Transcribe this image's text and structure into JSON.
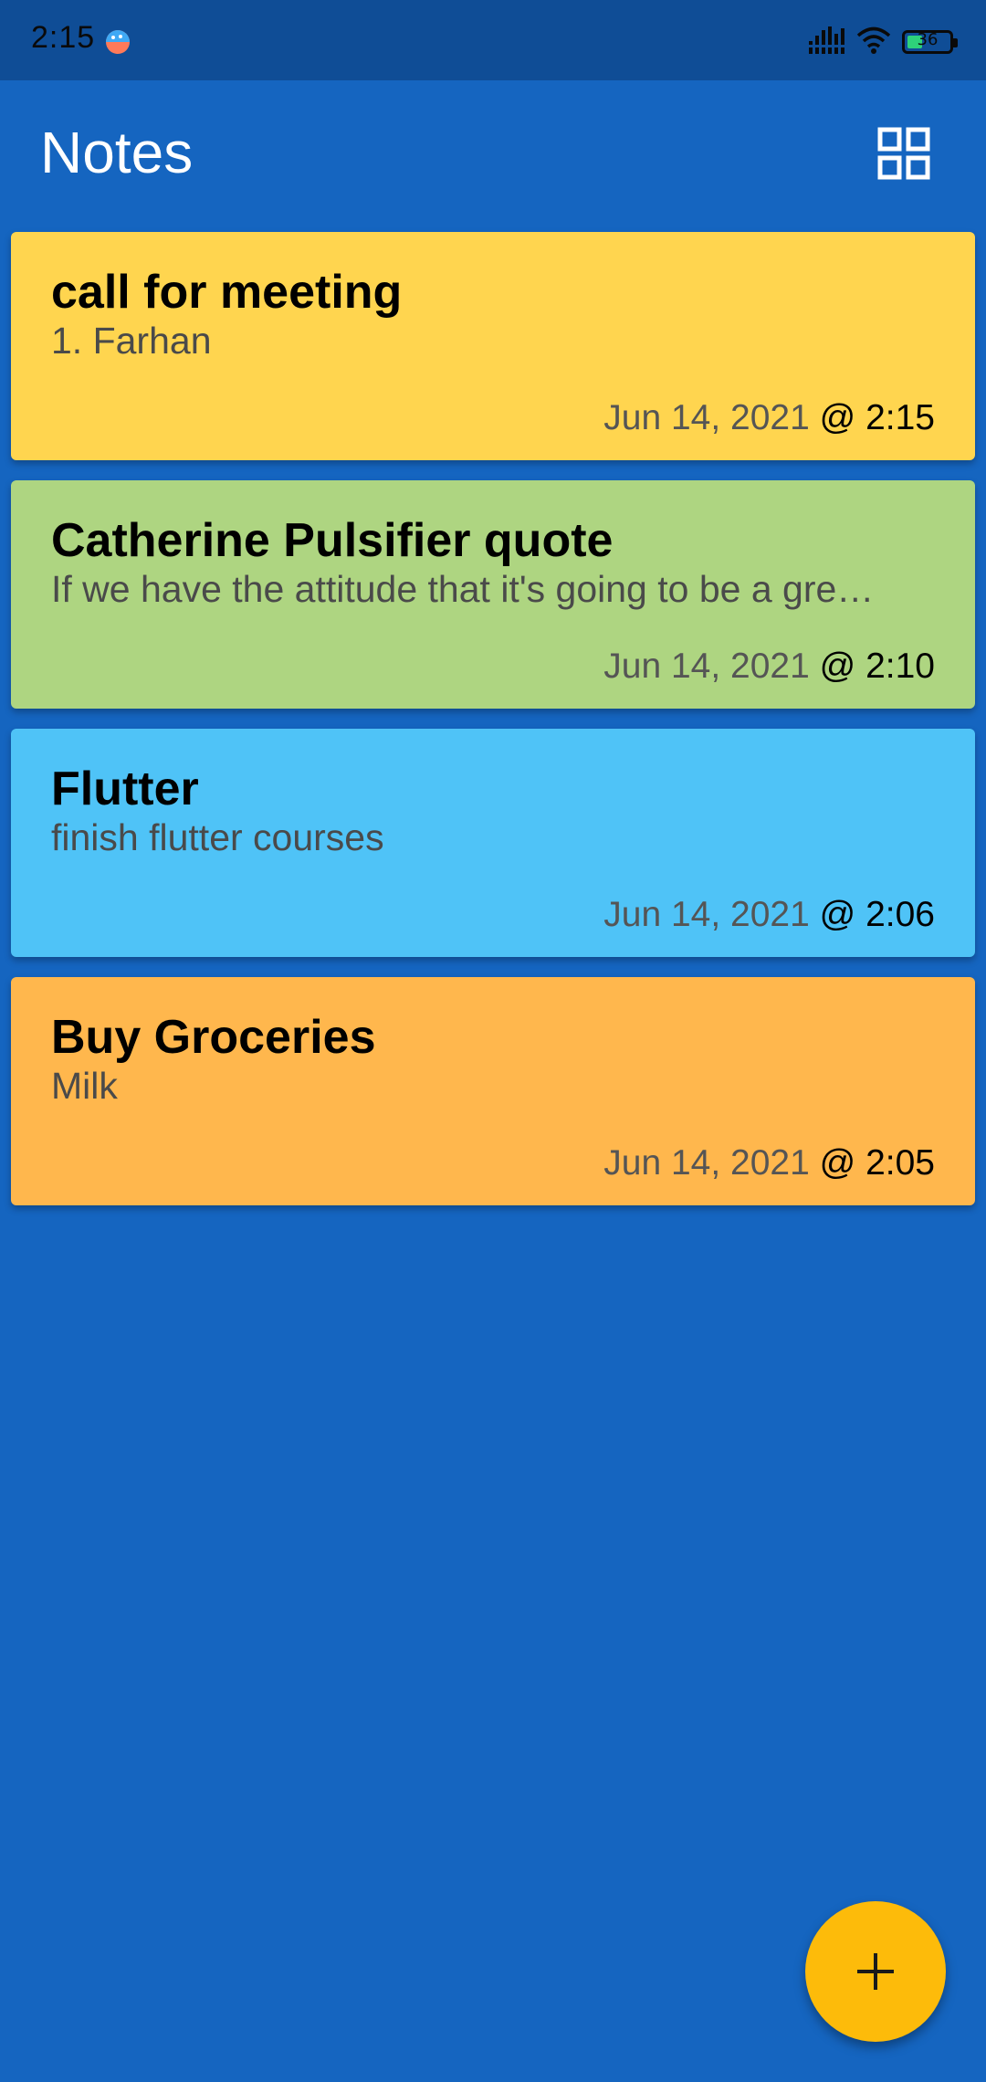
{
  "status_bar": {
    "time": "2:15",
    "battery_level": "36",
    "icons": [
      "app-notification-icon",
      "signal-icon",
      "wifi-icon",
      "battery-icon"
    ]
  },
  "app_bar": {
    "title": "Notes",
    "view_toggle_icon": "grid-view-icon"
  },
  "notes": [
    {
      "title": "call for meeting",
      "body": "1. Farhan",
      "date": "Jun 14, 2021",
      "time": "@ 2:15",
      "color": "#ffd54f"
    },
    {
      "title": "Catherine Pulsifier quote",
      "body": "If we have the attitude that it's going to be a gre…",
      "date": "Jun 14, 2021",
      "time": "@ 2:10",
      "color": "#aed581"
    },
    {
      "title": "Flutter",
      "body": "finish flutter courses",
      "date": "Jun 14, 2021",
      "time": "@ 2:06",
      "color": "#4fc3f7"
    },
    {
      "title": "Buy Groceries",
      "body": "Milk",
      "date": "Jun 14, 2021",
      "time": "@ 2:05",
      "color": "#ffb74d"
    }
  ],
  "fab": {
    "icon": "add-icon",
    "color": "#fdbb0a"
  },
  "colors": {
    "background": "#1565c0",
    "status_bar": "#0f4d96"
  }
}
